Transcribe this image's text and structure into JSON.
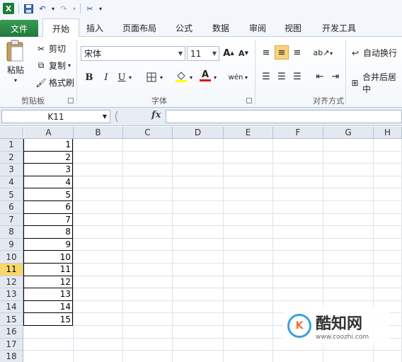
{
  "app": {
    "logo_letter": "X"
  },
  "qat": {
    "undo_arrow": "▾",
    "redo_arrow": "▾",
    "more": "▾"
  },
  "tabs": [
    {
      "label": "文件"
    },
    {
      "label": "开始"
    },
    {
      "label": "插入"
    },
    {
      "label": "页面布局"
    },
    {
      "label": "公式"
    },
    {
      "label": "数据"
    },
    {
      "label": "审阅"
    },
    {
      "label": "视图"
    },
    {
      "label": "开发工具"
    }
  ],
  "clipboard": {
    "paste": "粘贴",
    "cut": "剪切",
    "copy": "复制",
    "format_painter": "格式刷",
    "group": "剪贴板"
  },
  "font": {
    "name": "宋体",
    "size": "11",
    "grow": "A",
    "shrink": "A",
    "bold": "B",
    "italic": "I",
    "underline": "U",
    "font_color": "A",
    "phonetic": "wén",
    "group": "字体"
  },
  "alignment": {
    "wrap": "自动换行",
    "merge": "合并后居中",
    "group": "对齐方式"
  },
  "formula_bar": {
    "name_box": "K11",
    "fx": "fx",
    "value": ""
  },
  "columns": [
    "A",
    "B",
    "C",
    "D",
    "E",
    "F",
    "G",
    "H"
  ],
  "rows": [
    "1",
    "2",
    "3",
    "4",
    "5",
    "6",
    "7",
    "8",
    "9",
    "10",
    "11",
    "12",
    "13",
    "14",
    "15",
    "16",
    "17",
    "18"
  ],
  "selected_row": "11",
  "cells_A": [
    "1",
    "2",
    "3",
    "4",
    "5",
    "6",
    "7",
    "8",
    "9",
    "10",
    "11",
    "12",
    "13",
    "14",
    "15"
  ],
  "watermark": {
    "logo": "K",
    "name": "酷知网",
    "url": "www.coozhi.com"
  },
  "colors": {
    "file_tab": "#217346",
    "selected_row": "#f7d86a",
    "highlight": "#ffff00",
    "font_red": "#e01010"
  }
}
